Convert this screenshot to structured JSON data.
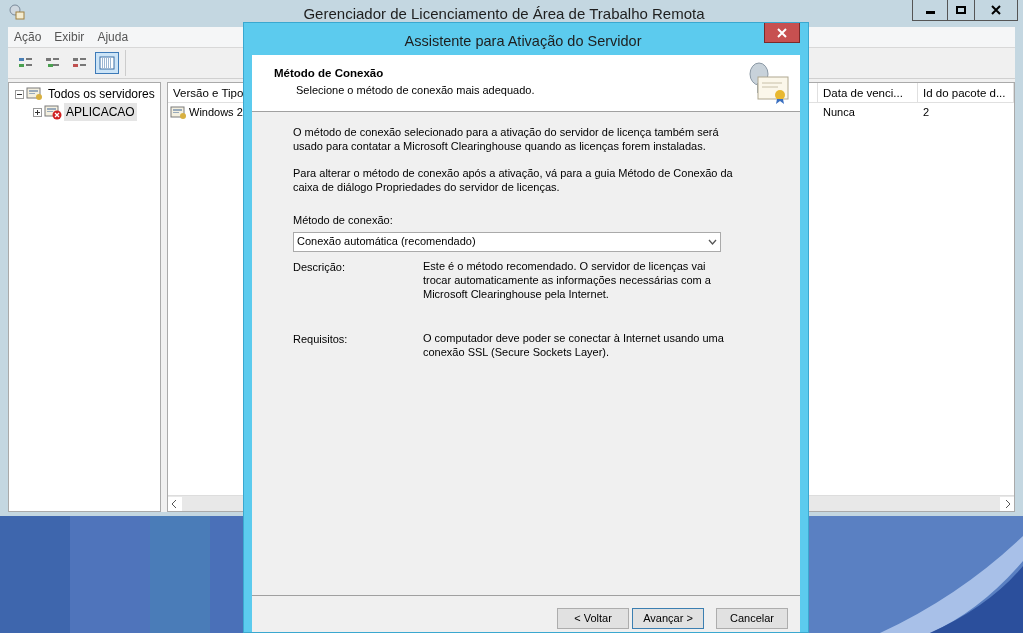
{
  "main_window": {
    "title": "Gerenciador de Licenciamento de Área de Trabalho Remota",
    "menu": [
      {
        "label": "Ação"
      },
      {
        "label": "Exibir"
      },
      {
        "label": "Ajuda"
      }
    ],
    "toolbar": [
      {
        "selected": false
      },
      {
        "selected": false
      },
      {
        "selected": false
      },
      {
        "selected": true
      }
    ],
    "tree": [
      {
        "label": "Todos os servidores",
        "expanded": true,
        "selected": false,
        "children": [
          {
            "label": "APLICACAO",
            "expanded": false,
            "selected": true
          }
        ]
      }
    ],
    "list": {
      "columns": [
        "Versão e Tipo",
        "Data de venci...",
        "Id do pacote d..."
      ],
      "rows": [
        [
          "Windows 2",
          "Nunca",
          "2"
        ]
      ]
    }
  },
  "dialog": {
    "title": "Assistente para Ativação do Servidor",
    "heading": "Método de Conexão",
    "subheading": "Selecione o método de conexão mais adequado.",
    "paragraphs": [
      "O método de conexão selecionado para a ativação do servidor de licença também será usado para contatar a Microsoft Clearinghouse quando as licenças forem instaladas.",
      "Para alterar o método de conexão após a ativação, vá para a guia Método de Conexão da caixa de diálogo Propriedades do servidor de licenças."
    ],
    "method_label": "Método de conexão:",
    "method_select": {
      "value": "Conexão automática (recomendado)"
    },
    "details": [
      {
        "label": "Descrição:",
        "text": "Este é o método recomendado. O servidor de licenças vai trocar automaticamente as informações necessárias com a Microsoft Clearinghouse pela Internet."
      },
      {
        "label": "Requisitos:",
        "text": "O computador deve poder se conectar à Internet usando uma conexão SSL (Secure Sockets Layer)."
      }
    ],
    "buttons": [
      {
        "label": "< Voltar",
        "default": false
      },
      {
        "label": "Avançar >",
        "default": true
      },
      {
        "label": "Cancelar",
        "default": false
      }
    ]
  }
}
